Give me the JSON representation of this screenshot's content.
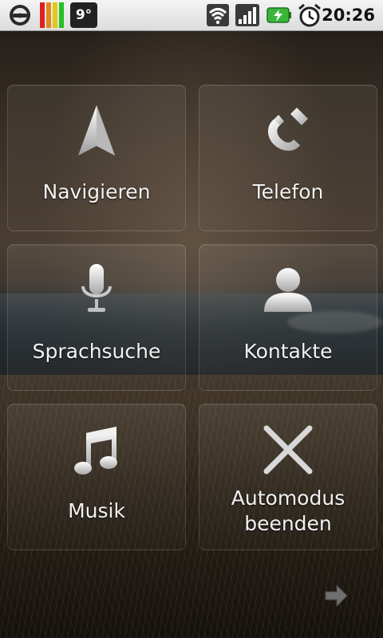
{
  "status_bar": {
    "weather_temp": "9°",
    "time": "20:26",
    "icons": [
      "car-icon",
      "signal-level-icon",
      "wifi-icon",
      "cell-signal-icon",
      "battery-charging-icon",
      "alarm-clock-icon"
    ],
    "colors": {
      "level_green": "#22c222",
      "level_yellow": "#e0c81e",
      "level_red": "#e02020",
      "battery_green": "#3ab53a"
    }
  },
  "tiles": [
    {
      "label": "Navigieren",
      "icon": "navigation-arrow-icon"
    },
    {
      "label": "Telefon",
      "icon": "phone-icon"
    },
    {
      "label": "Sprachsuche",
      "icon": "microphone-icon"
    },
    {
      "label": "Kontakte",
      "icon": "contact-person-icon"
    },
    {
      "label": "Musik",
      "icon": "music-note-icon"
    },
    {
      "label_line1": "Automodus",
      "label_line2": "beenden",
      "icon": "close-x-icon"
    }
  ],
  "next_page": {
    "icon": "arrow-right-icon"
  }
}
